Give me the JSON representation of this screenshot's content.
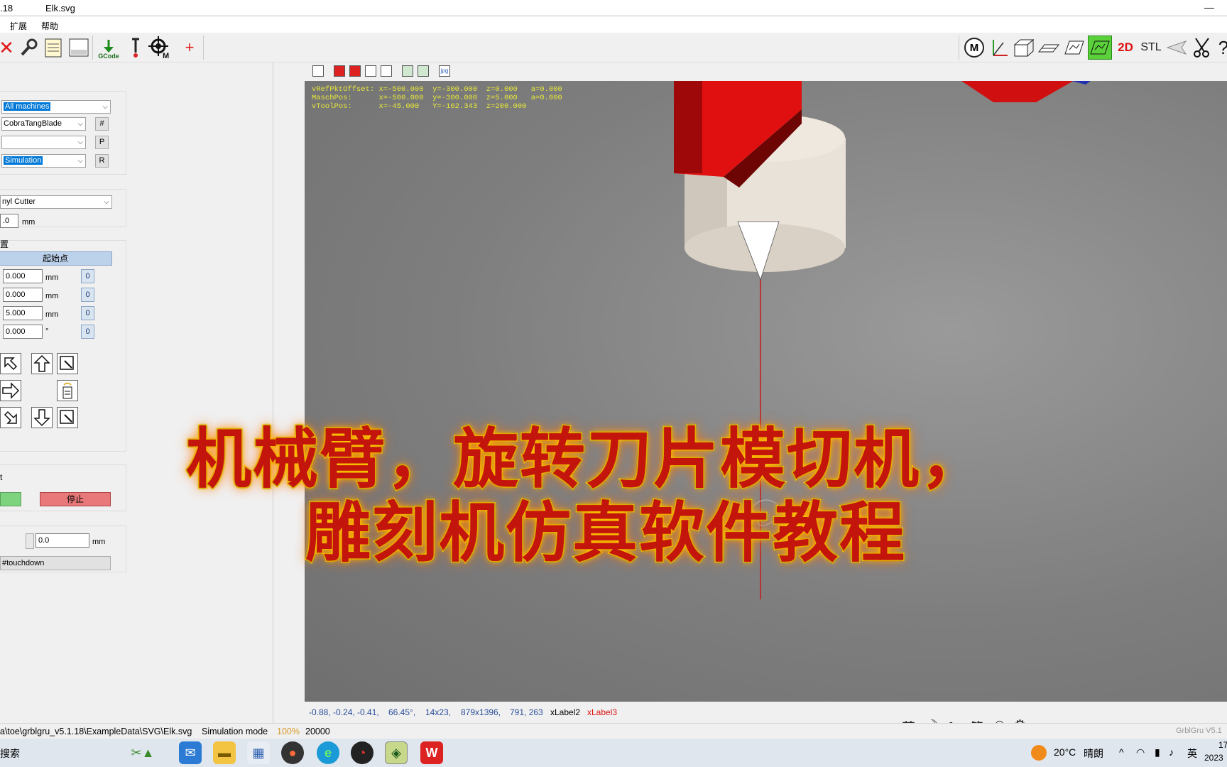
{
  "window": {
    "version": ".18",
    "file": "Elk.svg",
    "minimize": "—"
  },
  "menu": [
    "扩展",
    "帮助"
  ],
  "toolbar_left": {
    "gcode_label": "GCode"
  },
  "toolbar_right": {
    "m_label": "M",
    "twod_label": "2D",
    "stl_label": "STL"
  },
  "machine": {
    "all_machines": "All machines",
    "machine_type": "CobraTangBlade",
    "hash_btn": "#",
    "empty_combo": "",
    "p_btn": "P",
    "mode": "Simulation",
    "r_btn": "R"
  },
  "tool": {
    "name": "nyl Cutter",
    "value": ".0",
    "unit": "mm"
  },
  "position": {
    "section_label": "置",
    "header_btn": "起始点",
    "rows": [
      {
        "value": "0.000",
        "unit": "mm",
        "zero": "0"
      },
      {
        "value": "0.000",
        "unit": "mm",
        "zero": "0"
      },
      {
        "value": "5.000",
        "unit": "mm",
        "zero": "0"
      },
      {
        "value": "0.000",
        "unit": "°",
        "zero": "0"
      }
    ]
  },
  "run": {
    "section_label": "t",
    "stop_label": "停止"
  },
  "touch": {
    "value": "0.0",
    "unit": "mm",
    "btn": "#touchdown"
  },
  "viewtools": {
    "jpg": "jpg"
  },
  "overlay": {
    "line1": "vRefPktOffset: x=-500.000  y=-300.000  z=0.000   a=0.000",
    "line2": "MaschPos:      x=-500.000  y=-300.000  z=5.000   a=0.000",
    "line3": "vToolPos:      x=-45.000   Y=-162.343  z=200.000"
  },
  "title_line1": "机械臂，旋转刀片模切机，",
  "title_line2": "雕刻机仿真软件教程",
  "coords": {
    "values": "-0.88, -0.24, -0.41,",
    "angle": "66.45°,",
    "size": "14x23,",
    "res": "879x1396,",
    "pos": "791, 263",
    "label2": "xLabel2",
    "label3": "xLabel3"
  },
  "status": {
    "path": "a\\toe\\grblgru_v5.1.18\\ExampleData\\SVG\\Elk.svg",
    "mode": "Simulation mode",
    "percent": "100%",
    "count": "20000",
    "brand": "GrblGru V5.1"
  },
  "ime": {
    "lang": "英",
    "moon": "☽",
    "punct": "•,",
    "simp": "简",
    "smile": "☺",
    "gear": "⚙"
  },
  "taskbar": {
    "search": "搜索",
    "weather_temp": "20°C",
    "weather_desc": "晴朗",
    "lang": "英",
    "time": "17",
    "date": "2023"
  },
  "colors": {
    "accent_green": "#7ed47e",
    "stop_red": "#e8787a",
    "overlay_yellow": "#e8e83a",
    "title_red": "#c4150d"
  }
}
